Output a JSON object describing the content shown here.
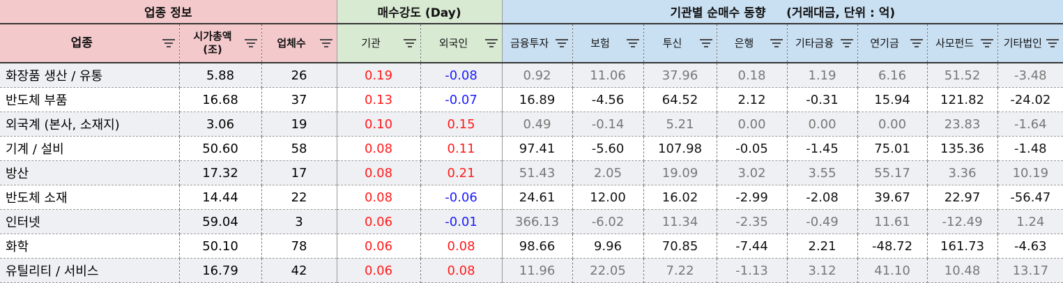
{
  "groups": {
    "sector_info": "업종 정보",
    "buying_power": "매수강도 (Day)",
    "inst_trend": "기관별 순매수 동향     (거래대금, 단위 : 억)"
  },
  "columns": {
    "sector": "업종",
    "market_cap_line1": "시가총액",
    "market_cap_line2": "(조)",
    "companies": "업체수",
    "institution": "기관",
    "foreigner": "외국인",
    "fin_invest": "금융투자",
    "insurance": "보험",
    "trust": "투신",
    "bank": "은행",
    "other_fin": "기타금융",
    "pension": "연기금",
    "private_fund": "사모펀드",
    "other_corp": "기타법인"
  },
  "rows": [
    {
      "sector": "화장품 생산 / 유통",
      "market_cap": "5.88",
      "companies": "26",
      "institution": "0.19",
      "foreigner": "-0.08",
      "fin_invest": "0.92",
      "insurance": "11.06",
      "trust": "37.96",
      "bank": "0.18",
      "other_fin": "1.19",
      "pension": "6.16",
      "private_fund": "51.52",
      "other_corp": "-3.48"
    },
    {
      "sector": "반도체 부품",
      "market_cap": "16.68",
      "companies": "37",
      "institution": "0.13",
      "foreigner": "-0.07",
      "fin_invest": "16.89",
      "insurance": "-4.56",
      "trust": "64.52",
      "bank": "2.12",
      "other_fin": "-0.31",
      "pension": "15.94",
      "private_fund": "121.82",
      "other_corp": "-24.02"
    },
    {
      "sector": "외국계 (본사, 소재지)",
      "market_cap": "3.06",
      "companies": "19",
      "institution": "0.10",
      "foreigner": "0.15",
      "fin_invest": "0.49",
      "insurance": "-0.14",
      "trust": "5.21",
      "bank": "0.00",
      "other_fin": "0.00",
      "pension": "0.00",
      "private_fund": "23.83",
      "other_corp": "-1.64"
    },
    {
      "sector": "기계 / 설비",
      "market_cap": "50.60",
      "companies": "58",
      "institution": "0.08",
      "foreigner": "0.11",
      "fin_invest": "97.41",
      "insurance": "-5.60",
      "trust": "107.98",
      "bank": "-0.05",
      "other_fin": "-1.45",
      "pension": "75.01",
      "private_fund": "135.36",
      "other_corp": "-1.48"
    },
    {
      "sector": "방산",
      "market_cap": "17.32",
      "companies": "17",
      "institution": "0.08",
      "foreigner": "0.21",
      "fin_invest": "51.43",
      "insurance": "2.05",
      "trust": "19.09",
      "bank": "3.02",
      "other_fin": "3.55",
      "pension": "55.17",
      "private_fund": "3.36",
      "other_corp": "10.19"
    },
    {
      "sector": "반도체 소재",
      "market_cap": "14.44",
      "companies": "22",
      "institution": "0.08",
      "foreigner": "-0.06",
      "fin_invest": "24.61",
      "insurance": "12.00",
      "trust": "16.02",
      "bank": "-2.99",
      "other_fin": "-2.08",
      "pension": "39.67",
      "private_fund": "22.97",
      "other_corp": "-56.47"
    },
    {
      "sector": "인터넷",
      "market_cap": "59.04",
      "companies": "3",
      "institution": "0.06",
      "foreigner": "-0.01",
      "fin_invest": "366.13",
      "insurance": "-6.02",
      "trust": "11.34",
      "bank": "-2.35",
      "other_fin": "-0.49",
      "pension": "11.61",
      "private_fund": "-12.49",
      "other_corp": "1.24"
    },
    {
      "sector": "화학",
      "market_cap": "50.10",
      "companies": "78",
      "institution": "0.06",
      "foreigner": "0.08",
      "fin_invest": "98.66",
      "insurance": "9.96",
      "trust": "70.85",
      "bank": "-7.44",
      "other_fin": "2.21",
      "pension": "-48.72",
      "private_fund": "161.73",
      "other_corp": "-4.63"
    },
    {
      "sector": "유틸리티 / 서비스",
      "market_cap": "16.79",
      "companies": "42",
      "institution": "0.06",
      "foreigner": "0.08",
      "fin_invest": "11.96",
      "insurance": "22.05",
      "trust": "7.22",
      "bank": "-1.13",
      "other_fin": "3.12",
      "pension": "41.10",
      "private_fund": "10.48",
      "other_corp": "13.17"
    }
  ],
  "colors": {
    "sector_header": "#f4c9cc",
    "power_header": "#d9ead3",
    "inst_header": "#c9dff2",
    "positive": "#ff1a1a",
    "negative": "#1a1aff",
    "row_shade": "#eef0f3"
  },
  "icons": {
    "filter": "filter-icon"
  }
}
